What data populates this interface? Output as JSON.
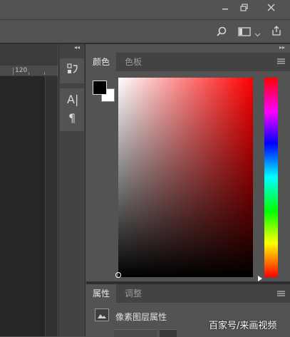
{
  "window": {
    "minimize_icon": "minimize-icon",
    "restore_icon": "restore-icon",
    "close_icon": "close-icon"
  },
  "options_bar": {
    "search_icon": "search-icon",
    "workspace_icon": "workspace-icon",
    "dropdown_icon": "chevron-down-icon",
    "share_icon": "share-icon"
  },
  "ruler": {
    "tick_label": "120"
  },
  "toolstrip": {
    "tools": [
      {
        "name": "swatch-history-icon"
      },
      {
        "name": "character-icon",
        "glyph": "A|"
      },
      {
        "name": "paragraph-icon",
        "glyph": "¶"
      }
    ]
  },
  "color_panel": {
    "tabs": [
      {
        "label": "颜色",
        "active": true
      },
      {
        "label": "色板",
        "active": false
      }
    ],
    "foreground": "#000000",
    "background": "#ffffff",
    "hue_color": "#ff0000",
    "hue_slider_level": 1.0
  },
  "properties_panel": {
    "tabs": [
      {
        "label": "属性",
        "active": true
      },
      {
        "label": "调整",
        "active": false
      }
    ],
    "layer_type_label": "像素图层属性"
  },
  "watermark": "百家号/来画视频"
}
